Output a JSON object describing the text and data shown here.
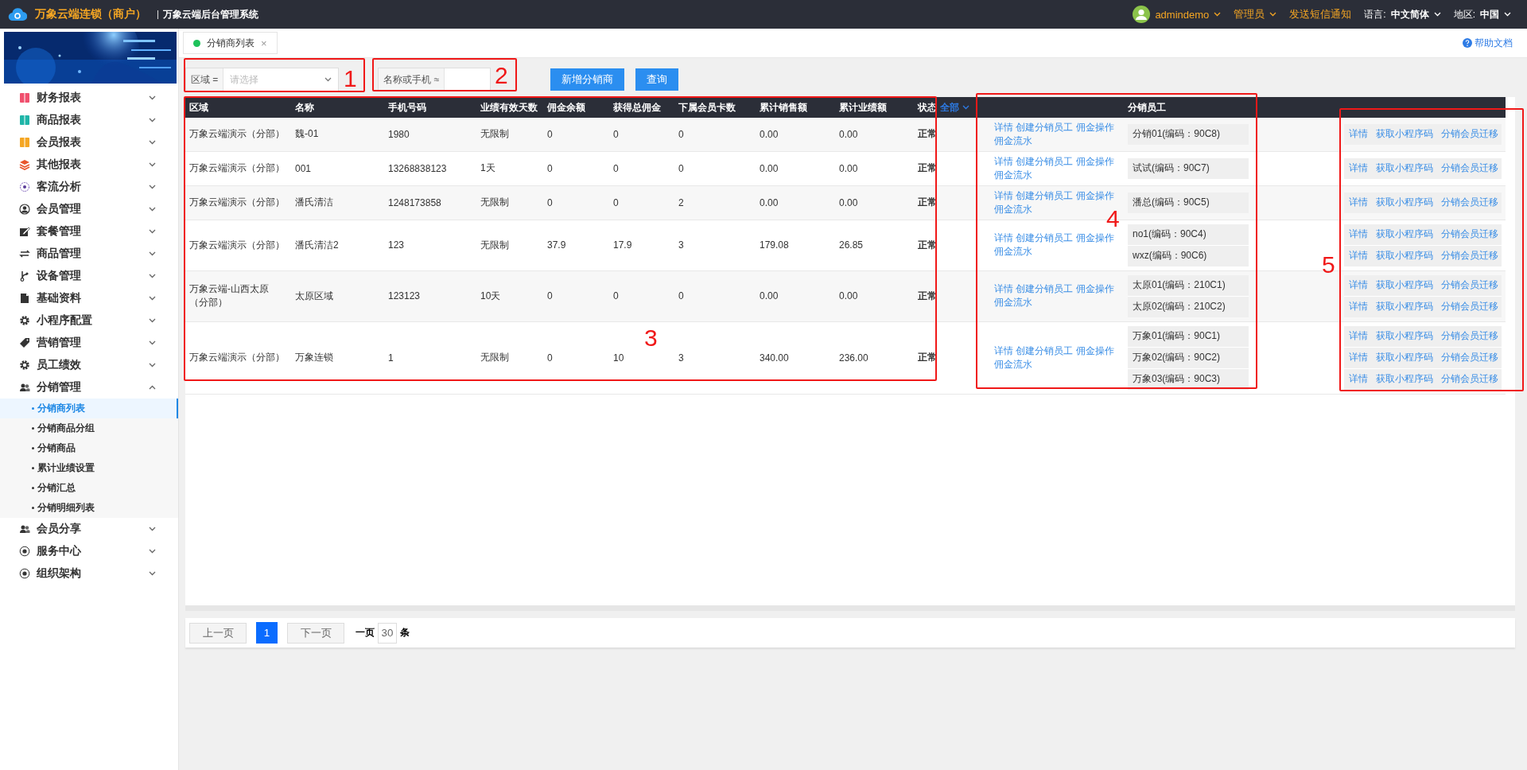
{
  "header": {
    "brand": "万象云端连锁（商户）",
    "subtitle": "万象云端后台管理系统",
    "user": "admindemo",
    "role": "管理员",
    "sms_link": "发送短信通知",
    "language_label": "语言:",
    "language": "中文简体",
    "region_label": "地区:",
    "region": "中国"
  },
  "sidebar": {
    "items": [
      {
        "label": "财务报表",
        "expanded": false
      },
      {
        "label": "商品报表",
        "expanded": false
      },
      {
        "label": "会员报表",
        "expanded": false
      },
      {
        "label": "其他报表",
        "expanded": false
      },
      {
        "label": "客流分析",
        "expanded": false
      },
      {
        "label": "会员管理",
        "expanded": false
      },
      {
        "label": "套餐管理",
        "expanded": false
      },
      {
        "label": "商品管理",
        "expanded": false
      },
      {
        "label": "设备管理",
        "expanded": false
      },
      {
        "label": "基础资料",
        "expanded": false
      },
      {
        "label": "小程序配置",
        "expanded": false
      },
      {
        "label": "营销管理",
        "expanded": false
      },
      {
        "label": "员工绩效",
        "expanded": false
      },
      {
        "label": "分销管理",
        "expanded": true,
        "children": [
          {
            "label": "分销商列表",
            "selected": true
          },
          {
            "label": "分销商品分组",
            "selected": false
          },
          {
            "label": "分销商品",
            "selected": false
          },
          {
            "label": "累计业绩设置",
            "selected": false
          },
          {
            "label": "分销汇总",
            "selected": false
          },
          {
            "label": "分销明细列表",
            "selected": false
          }
        ]
      },
      {
        "label": "会员分享",
        "expanded": false
      },
      {
        "label": "服务中心",
        "expanded": false
      },
      {
        "label": "组织架构",
        "expanded": false
      }
    ]
  },
  "tabs": [
    {
      "label": "分销商列表",
      "selected": true,
      "close": "×"
    }
  ],
  "help_link": "帮助文档",
  "filters": {
    "region": {
      "label": "区域 =",
      "placeholder": "请选择"
    },
    "keyword": {
      "label": "名称或手机 ≈"
    },
    "buttons": [
      "新增分销商",
      "查询"
    ]
  },
  "table": {
    "columns": [
      "区域",
      "名称",
      "手机号码",
      "业绩有效天数",
      "佣金余额",
      "获得总佣金",
      "下属会员卡数",
      "累计销售额",
      "累计业绩额",
      "状态"
    ],
    "status_filter": "全部",
    "employees_column": "分销员工",
    "rows": [
      {
        "area": "万象云端演示（分部）",
        "name": "魏-01",
        "phone": "1980",
        "days": "无限制",
        "balance": "0",
        "commission": "0",
        "cards": "0",
        "sales": "0.00",
        "performance": "0.00",
        "status": "正常",
        "actions": [
          "详情",
          "创建分销员工",
          "佣金操作",
          "佣金流水"
        ],
        "employees": [
          {
            "name": "分销01(编码：90C8)",
            "actions": [
              "详情",
              "获取小程序码",
              "分销会员迁移"
            ]
          }
        ]
      },
      {
        "area": "万象云端演示（分部）",
        "name": "001",
        "phone": "13268838123",
        "days": "1天",
        "balance": "0",
        "commission": "0",
        "cards": "0",
        "sales": "0.00",
        "performance": "0.00",
        "status": "正常",
        "actions": [
          "详情",
          "创建分销员工",
          "佣金操作",
          "佣金流水"
        ],
        "employees": [
          {
            "name": "试试(编码：90C7)",
            "actions": [
              "详情",
              "获取小程序码",
              "分销会员迁移"
            ]
          }
        ]
      },
      {
        "area": "万象云端演示（分部）",
        "name": "潘氏清洁",
        "phone": "1248173858",
        "days": "无限制",
        "balance": "0",
        "commission": "0",
        "cards": "2",
        "sales": "0.00",
        "performance": "0.00",
        "status": "正常",
        "actions": [
          "详情",
          "创建分销员工",
          "佣金操作",
          "佣金流水"
        ],
        "employees": [
          {
            "name": "潘总(编码：90C5)",
            "actions": [
              "详情",
              "获取小程序码",
              "分销会员迁移"
            ]
          }
        ]
      },
      {
        "area": "万象云端演示（分部）",
        "name": "潘氏清洁2",
        "phone": "123",
        "days": "无限制",
        "balance": "37.9",
        "commission": "17.9",
        "cards": "3",
        "sales": "179.08",
        "performance": "26.85",
        "status": "正常",
        "actions": [
          "详情",
          "创建分销员工",
          "佣金操作",
          "佣金流水"
        ],
        "employees": [
          {
            "name": "no1(编码：90C4)",
            "actions": [
              "详情",
              "获取小程序码",
              "分销会员迁移"
            ]
          },
          {
            "name": "wxz(编码：90C6)",
            "actions": [
              "详情",
              "获取小程序码",
              "分销会员迁移"
            ]
          }
        ]
      },
      {
        "area": "万象云端-山西太原（分部）",
        "name": "太原区域",
        "phone": "123123",
        "days": "10天",
        "balance": "0",
        "commission": "0",
        "cards": "0",
        "sales": "0.00",
        "performance": "0.00",
        "status": "正常",
        "actions": [
          "详情",
          "创建分销员工",
          "佣金操作",
          "佣金流水"
        ],
        "employees": [
          {
            "name": "太原01(编码：210C1)",
            "actions": [
              "详情",
              "获取小程序码",
              "分销会员迁移"
            ]
          },
          {
            "name": "太原02(编码：210C2)",
            "actions": [
              "详情",
              "获取小程序码",
              "分销会员迁移"
            ]
          }
        ]
      },
      {
        "area": "万象云端演示（分部）",
        "name": "万象连锁",
        "phone": "1",
        "days": "无限制",
        "balance": "0",
        "commission": "10",
        "cards": "3",
        "sales": "340.00",
        "performance": "236.00",
        "status": "正常",
        "actions": [
          "详情",
          "创建分销员工",
          "佣金操作",
          "佣金流水"
        ],
        "employees": [
          {
            "name": "万象01(编码：90C1)",
            "actions": [
              "详情",
              "获取小程序码",
              "分销会员迁移"
            ]
          },
          {
            "name": "万象02(编码：90C2)",
            "actions": [
              "详情",
              "获取小程序码",
              "分销会员迁移"
            ]
          },
          {
            "name": "万象03(编码：90C3)",
            "actions": [
              "详情",
              "获取小程序码",
              "分销会员迁移"
            ]
          }
        ]
      }
    ]
  },
  "pagination": {
    "previous": "上一页",
    "pages": [
      {
        "label": "1",
        "selected": true
      }
    ],
    "next": "下一页",
    "per_page_label": "一页",
    "per_page": "30",
    "unit": "条"
  },
  "annotations": [
    {
      "label": "1"
    },
    {
      "label": "2"
    },
    {
      "label": "3"
    },
    {
      "label": "4"
    },
    {
      "label": "5"
    }
  ]
}
